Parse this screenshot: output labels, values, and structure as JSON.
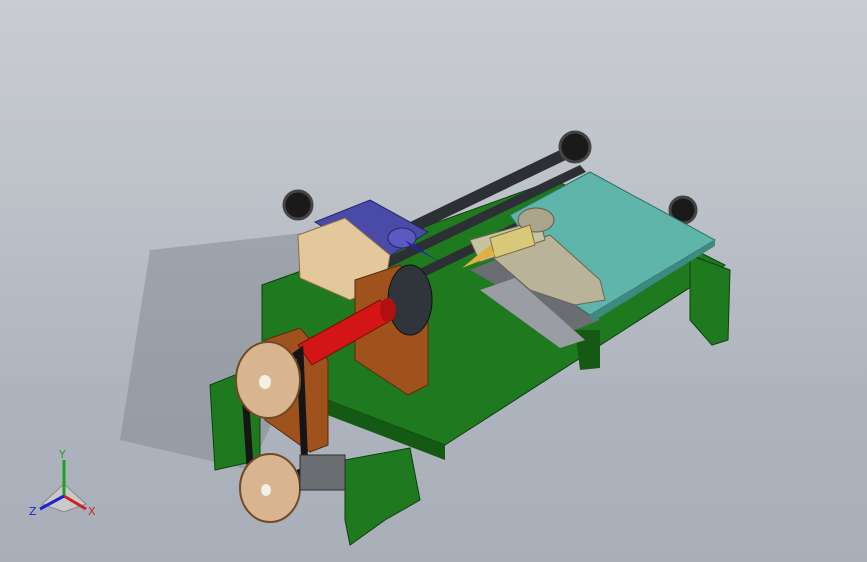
{
  "triad": {
    "x_label": "X",
    "y_label": "Y",
    "z_label": "Z"
  },
  "colors": {
    "background_top": "#c9ccd2",
    "background_bottom": "#a9afb8",
    "frame_green": "#1f7a1f",
    "frame_green_dark": "#145a14",
    "shaft_red": "#d41515",
    "support_brown": "#a0521d",
    "pulley_tan": "#d9b58f",
    "belt_black": "#151515",
    "rail_dark": "#2c2f33",
    "carriage_blue": "#4a4aa8",
    "block_tan": "#e2c89a",
    "table_teal": "#5fb5aa",
    "tool_holder_grey": "#b9b39a",
    "axis_x": "#d02020",
    "axis_y": "#20a020",
    "axis_z": "#2020d0"
  }
}
